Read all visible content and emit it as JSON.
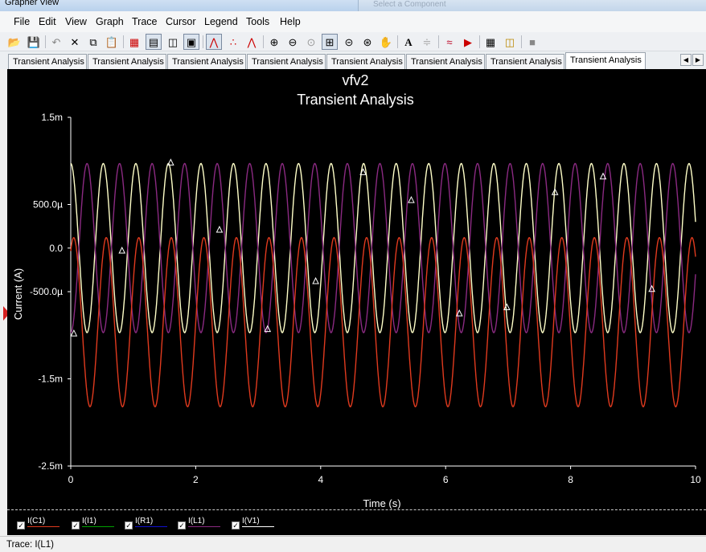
{
  "window": {
    "title": "Grapher View",
    "background_window_label": "Select a Component"
  },
  "menu": [
    "File",
    "Edit",
    "View",
    "Graph",
    "Trace",
    "Cursor",
    "Legend",
    "Tools",
    "Help"
  ],
  "toolbar_icons": [
    "open-icon",
    "save-icon",
    "undo-icon",
    "delete-icon",
    "copy-icon",
    "paste-icon",
    "grid-icon",
    "legend-icon",
    "data-table-icon",
    "reverse-colors-icon",
    "line-trace-icon",
    "dot-trace-icon",
    "line-dot-trace-icon",
    "zoom-in-icon",
    "zoom-out-icon",
    "zoom-full-icon",
    "zoom-area-icon",
    "zoom-x-icon",
    "zoom-y-icon",
    "pan-icon",
    "text-icon",
    "label-icon",
    "cursor-icon",
    "export-icon",
    "properties-icon",
    "overlay-icon",
    "stop-icon"
  ],
  "tabs": [
    "Transient Analysis",
    "Transient Analysis",
    "Transient Analysis",
    "Transient Analysis",
    "Transient Analysis",
    "Transient Analysis",
    "Transient Analysis",
    "Transient Analysis"
  ],
  "active_tab": 7,
  "legend": [
    {
      "label": "I(C1)",
      "color": "#e03a1e",
      "checked": true
    },
    {
      "label": "I(I1)",
      "color": "#00a000",
      "checked": true
    },
    {
      "label": "I(R1)",
      "color": "#1010d0",
      "checked": true
    },
    {
      "label": "I(L1)",
      "color": "#8b2a82",
      "checked": true
    },
    {
      "label": "I(V1)",
      "color": "#ffffff",
      "checked": true
    }
  ],
  "status": "Trace: I(L1)",
  "chart_data": {
    "type": "line",
    "title": "vfv2",
    "subtitle": "Transient Analysis",
    "xlabel": "Time (s)",
    "ylabel": "Current (A)",
    "xlim": [
      0,
      10
    ],
    "ylim": [
      -0.0025,
      0.0015
    ],
    "x_ticks": [
      0,
      2,
      4,
      6,
      8,
      10
    ],
    "x_tick_labels": [
      "0",
      "2",
      "4",
      "6",
      "8",
      "10"
    ],
    "y_ticks": [
      0.0015,
      0.0005,
      0,
      -0.0005,
      -0.0015,
      -0.0025
    ],
    "y_tick_labels": [
      "1.5m",
      "500.0µ",
      "0.0",
      "-500.0µ",
      "-1.5m",
      "-2.5m"
    ],
    "grid": false,
    "series": [
      {
        "name": "I(V1)",
        "color": "#ffffc8",
        "shape": "sine",
        "offset": 0.0,
        "amplitude": 0.00097,
        "frequency_hz": 1.92,
        "phase": 1.5708
      },
      {
        "name": "I(L1)",
        "color": "#8b2a82",
        "shape": "sine",
        "offset": 0.0,
        "amplitude": 0.00097,
        "frequency_hz": 1.92,
        "phase": -1.5708
      },
      {
        "name": "I(C1)",
        "color": "#e03a1e",
        "shape": "sine",
        "offset": -0.00085,
        "amplitude": 0.00097,
        "frequency_hz": 1.92,
        "phase": 1.0
      }
    ],
    "markers": [
      {
        "x": 0.05,
        "y": -0.00098
      },
      {
        "x": 0.82,
        "y": -3e-05
      },
      {
        "x": 1.6,
        "y": 0.00098
      },
      {
        "x": 2.38,
        "y": 0.00021
      },
      {
        "x": 3.15,
        "y": -0.00093
      },
      {
        "x": 3.92,
        "y": -0.00038
      },
      {
        "x": 4.68,
        "y": 0.00087
      },
      {
        "x": 5.45,
        "y": 0.00055
      },
      {
        "x": 6.22,
        "y": -0.00075
      },
      {
        "x": 6.98,
        "y": -0.00068
      },
      {
        "x": 7.75,
        "y": 0.00064
      },
      {
        "x": 8.52,
        "y": 0.00082
      },
      {
        "x": 9.3,
        "y": -0.00047
      }
    ]
  }
}
